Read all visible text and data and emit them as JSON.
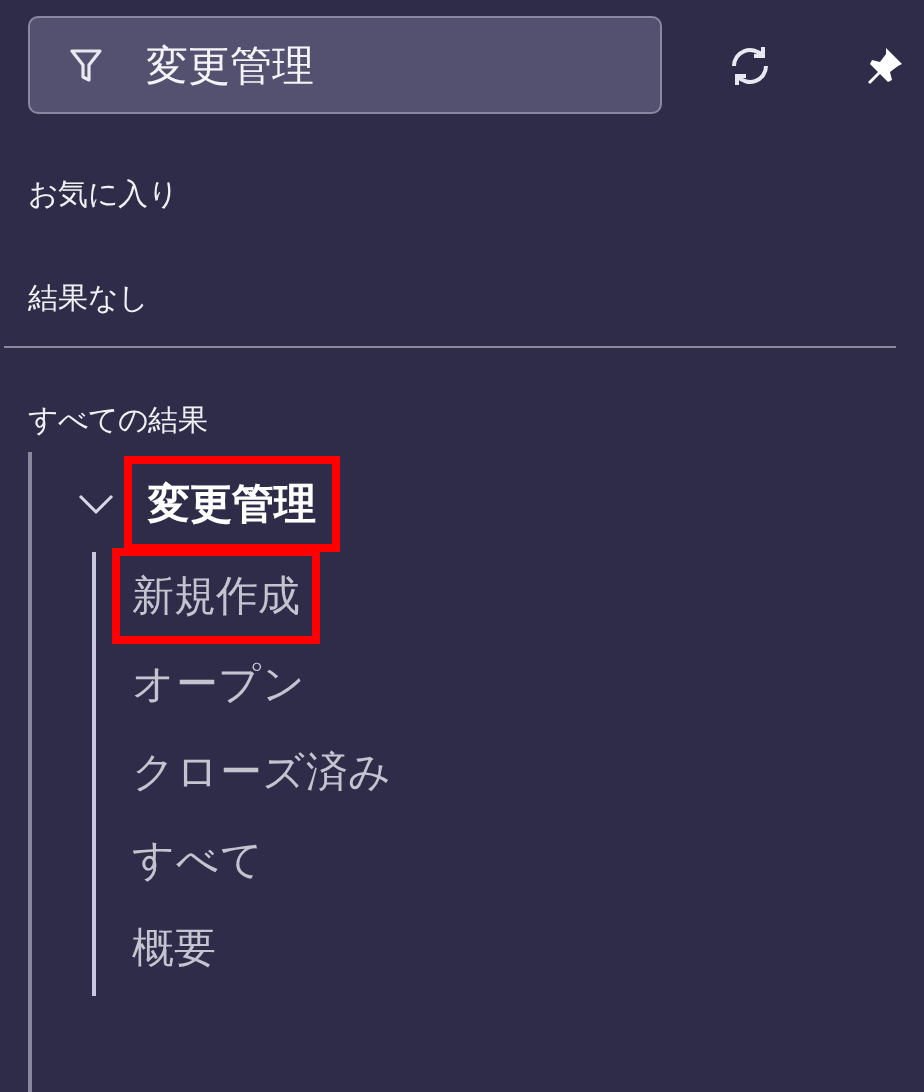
{
  "search": {
    "value": "変更管理"
  },
  "sections": [
    {
      "label": "お気に入り"
    },
    {
      "label": "結果なし"
    }
  ],
  "results_heading": "すべての結果",
  "tree": {
    "label": "変更管理",
    "expanded": true,
    "highlighted": true,
    "children": [
      {
        "label": "新規作成",
        "highlighted": true
      },
      {
        "label": "オープン",
        "highlighted": false
      },
      {
        "label": "クローズ済み",
        "highlighted": false
      },
      {
        "label": "すべて",
        "highlighted": false
      },
      {
        "label": "概要",
        "highlighted": false
      }
    ]
  }
}
